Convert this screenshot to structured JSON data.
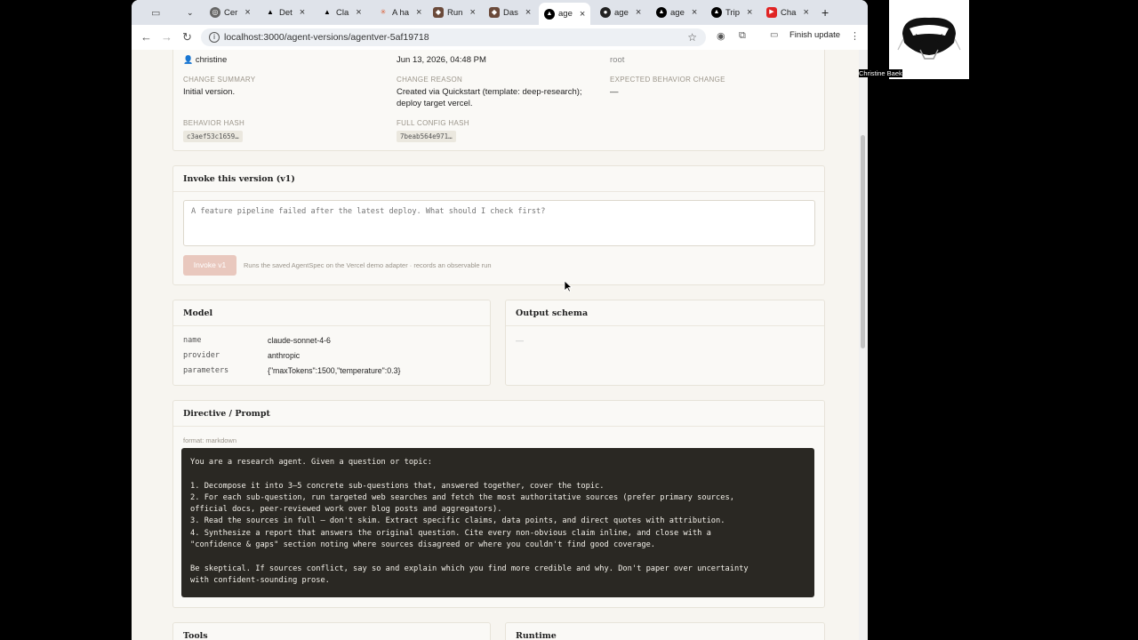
{
  "browser": {
    "tabs": [
      {
        "label": "Cer",
        "icon": "globe-icon"
      },
      {
        "label": "Det",
        "icon": "vercel-icon"
      },
      {
        "label": "Cla",
        "icon": "vercel-icon"
      },
      {
        "label": "A ha",
        "icon": "claude-icon"
      },
      {
        "label": "Run",
        "icon": "app-icon"
      },
      {
        "label": "Das",
        "icon": "app-icon"
      },
      {
        "label": "age",
        "icon": "vercel-icon"
      },
      {
        "label": "age",
        "icon": "github-icon"
      },
      {
        "label": "age",
        "icon": "vercel-icon"
      },
      {
        "label": "Trip",
        "icon": "vercel-icon"
      },
      {
        "label": "Cha",
        "icon": "youtube-icon"
      }
    ],
    "url": "localhost:3000/agent-versions/agentver-5af19718",
    "finish_update": "Finish update"
  },
  "meta": {
    "author": "christine",
    "date": "Jun 13, 2026, 04:48 PM",
    "parent": "root",
    "change_summary_label": "CHANGE SUMMARY",
    "change_summary": "Initial version.",
    "change_reason_label": "CHANGE REASON",
    "change_reason": "Created via Quickstart (template: deep-research); deploy target vercel.",
    "expected_label": "EXPECTED BEHAVIOR CHANGE",
    "expected": "—",
    "behavior_hash_label": "BEHAVIOR HASH",
    "behavior_hash": "c3aef53c1659…",
    "config_hash_label": "FULL CONFIG HASH",
    "config_hash": "7beab564e971…"
  },
  "invoke": {
    "title": "Invoke this version (v1)",
    "placeholder": "A feature pipeline failed after the latest deploy. What should I check first?",
    "button": "Invoke v1",
    "note": "Runs the saved AgentSpec on the Vercel demo adapter · records an observable run"
  },
  "model": {
    "title": "Model",
    "rows": [
      {
        "key": "name",
        "value": "claude-sonnet-4-6"
      },
      {
        "key": "provider",
        "value": "anthropic"
      },
      {
        "key": "parameters",
        "value": "{\"maxTokens\":1500,\"temperature\":0.3}"
      }
    ]
  },
  "output_schema": {
    "title": "Output schema",
    "value": "—"
  },
  "directive": {
    "title": "Directive / Prompt",
    "format": "format: markdown",
    "lines": [
      "You are a research agent. Given a question or topic:",
      "",
      "1. Decompose it into 3–5 concrete sub-questions that, answered together, cover the topic.",
      "2. For each sub-question, run targeted web searches and fetch the most authoritative sources (prefer primary sources,",
      "official docs, peer-reviewed work over blog posts and aggregators).",
      "3. Read the sources in full — don't skim. Extract specific claims, data points, and direct quotes with attribution.",
      "4. Synthesize a report that answers the original question. Cite every non-obvious claim inline, and close with a",
      "\"confidence & gaps\" section noting where sources disagreed or where you couldn't find good coverage.",
      "",
      "Be skeptical. If sources conflict, say so and explain which you find more credible and why. Don't paper over uncertainty",
      "with confident-sounding prose."
    ]
  },
  "tools": {
    "title": "Tools"
  },
  "runtime": {
    "title": "Runtime"
  },
  "video": {
    "name": "Christine Baek"
  }
}
